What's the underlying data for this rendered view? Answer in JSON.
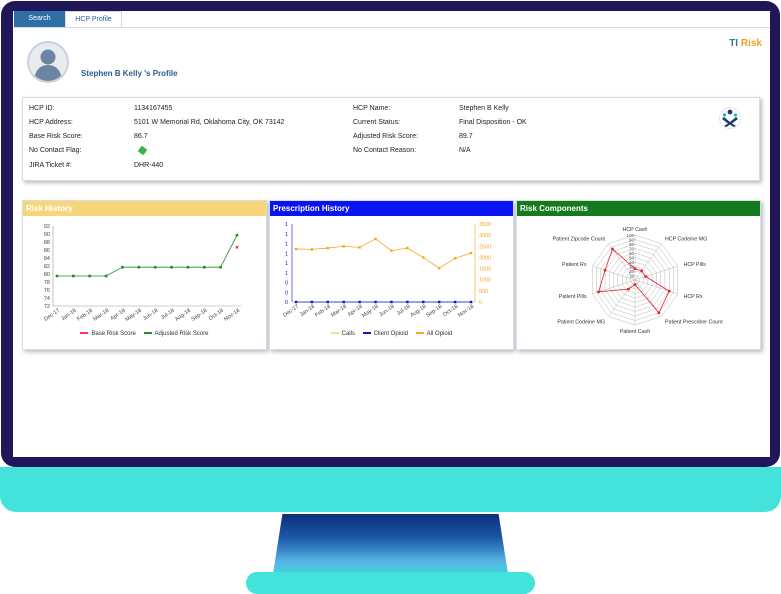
{
  "tabs": [
    {
      "label": "Search"
    },
    {
      "label": "HCP Profile"
    }
  ],
  "brand": {
    "ti": "TI",
    "risk": "Risk"
  },
  "profile_title": "Stephen B Kelly 's Profile",
  "info": {
    "hcp_id_label": "HCP ID:",
    "hcp_id": "1134167455",
    "hcp_address_label": "HCP Address:",
    "hcp_address": "5101 W Memorial Rd, Oklahoma City, OK 73142",
    "base_risk_label": "Base Risk Score:",
    "base_risk": "86.7",
    "no_contact_flag_label": "No Contact Flag:",
    "jira_label": "JIRA Ticket #:",
    "jira": "DHR-440",
    "hcp_name_label": "HCP Name:",
    "hcp_name": "Stephen B Kelly",
    "current_status_label": "Current Status:",
    "current_status": "Final Disposition - OK",
    "adjusted_risk_label": "Adjusted Risk Score:",
    "adjusted_risk": "89.7",
    "no_contact_reason_label": "No Contact Reason:",
    "no_contact_reason": "N/A"
  },
  "colors": {
    "risk_header": "#f7d57a",
    "rx_header": "#0a14f0",
    "comp_header": "#147a1c",
    "base_line": "#ff3366",
    "adjusted_line": "#1f8f1f",
    "calls": "#f7e08a",
    "client_opioid": "#0a14c8",
    "all_opioid": "#f5a623",
    "radar": "#e0202a"
  },
  "panels": {
    "risk_title": "Risk History",
    "rx_title": "Prescription History",
    "comp_title": "Risk Components"
  },
  "chart_data": [
    {
      "type": "line",
      "title": "Risk History",
      "x": [
        "Dec-17",
        "Jan-18",
        "Feb-18",
        "Mar-18",
        "Apr-18",
        "May-18",
        "Jun-18",
        "Jul-18",
        "Aug-18",
        "Sep-18",
        "Oct-18",
        "Nov-18"
      ],
      "ylim": [
        72,
        92
      ],
      "yticks": [
        72,
        74,
        76,
        78,
        80,
        82,
        84,
        86,
        88,
        90,
        92
      ],
      "series": [
        {
          "name": "Base Risk Score",
          "values": [
            null,
            null,
            null,
            null,
            null,
            null,
            null,
            null,
            null,
            null,
            null,
            86.7
          ]
        },
        {
          "name": "Adjusted Risk Score",
          "values": [
            79.5,
            79.5,
            79.5,
            79.5,
            81.7,
            81.7,
            81.7,
            81.7,
            81.7,
            81.7,
            81.7,
            89.7
          ]
        }
      ],
      "legend_position": "bottom"
    },
    {
      "type": "line",
      "title": "Prescription History",
      "x": [
        "Dec-17",
        "Jan-18",
        "Feb-18",
        "Mar-18",
        "Apr-18",
        "May-18",
        "Jun-18",
        "Jul-18",
        "Aug-18",
        "Sep-18",
        "Oct-18",
        "Nov-18"
      ],
      "ylim_left": [
        0,
        1
      ],
      "yticks_left": [
        "0",
        "0",
        "0",
        "1",
        "1",
        "1",
        "1",
        "1",
        "1"
      ],
      "ylim_right": [
        0,
        3500
      ],
      "yticks_right": [
        0,
        500,
        1000,
        1500,
        2000,
        2500,
        3000,
        3500
      ],
      "series": [
        {
          "name": "Calls",
          "axis": "left",
          "values": [
            0,
            0,
            0,
            0,
            0,
            0,
            0,
            0,
            0,
            0,
            0,
            0
          ]
        },
        {
          "name": "Client Opioid",
          "axis": "left",
          "values": [
            0,
            0,
            0,
            0,
            0,
            0,
            0,
            0,
            0,
            0,
            0,
            0
          ]
        },
        {
          "name": "All Opioid",
          "axis": "right",
          "values": [
            2380,
            2360,
            2420,
            2500,
            2450,
            2830,
            2300,
            2420,
            2000,
            1520,
            1960,
            2200
          ]
        }
      ],
      "legend_position": "bottom"
    },
    {
      "type": "radar",
      "title": "Risk Components",
      "categories": [
        "HCP Cash",
        "HCP Codeine MG",
        "HCP Pills",
        "HCP Rx",
        "Patient Prescriber Count",
        "Patient Cash",
        "Patient Codeine MG",
        "Patient Pills",
        "Patient Rx",
        "Patient Zipcode Count"
      ],
      "rticks": [
        10,
        20,
        30,
        40,
        50,
        60,
        70,
        80,
        90,
        100
      ],
      "series": [
        {
          "name": "",
          "values": [
            25,
            25,
            25,
            80,
            90,
            10,
            25,
            85,
            70,
            85
          ]
        }
      ]
    }
  ]
}
